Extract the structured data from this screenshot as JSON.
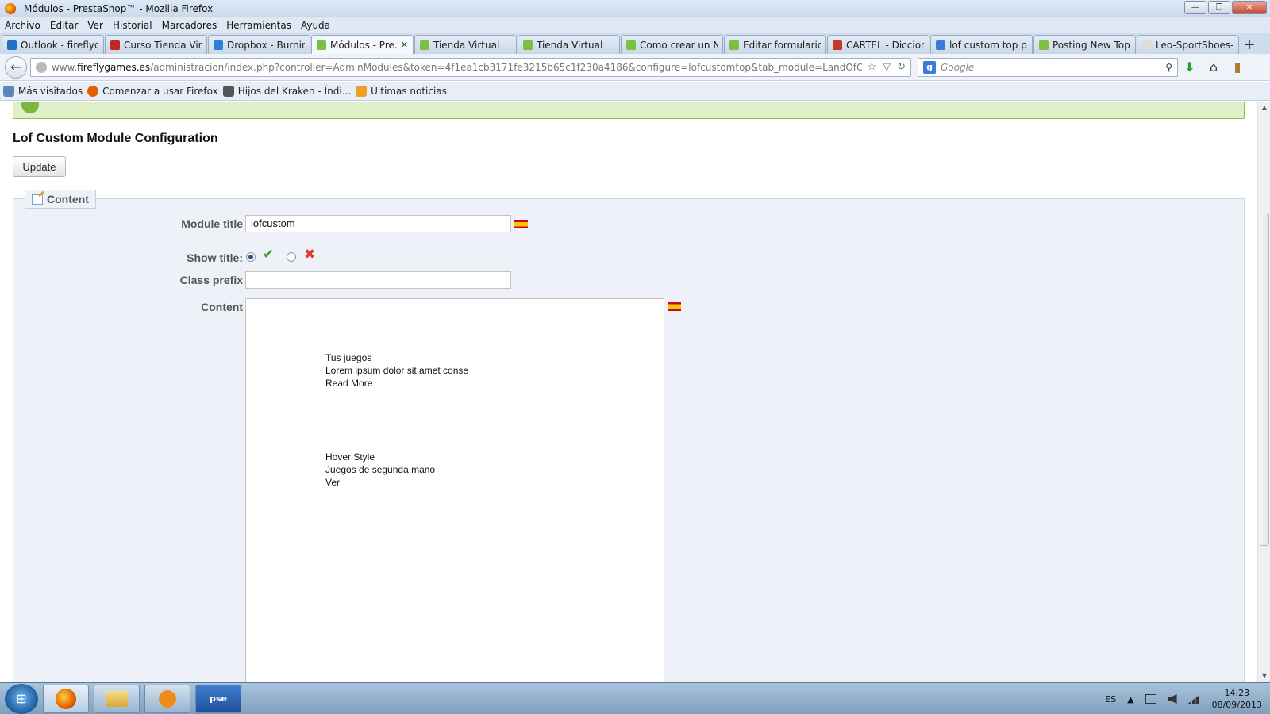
{
  "window": {
    "title": "Módulos - PrestaShop™ - Mozilla Firefox",
    "min_symbol": "—",
    "restore_symbol": "❐",
    "close_symbol": "✕"
  },
  "menu": {
    "items": [
      "Archivo",
      "Editar",
      "Ver",
      "Historial",
      "Marcadores",
      "Herramientas",
      "Ayuda"
    ]
  },
  "tabs": [
    {
      "label": "Outlook - fireflyd...",
      "icon_color": "#1f6fc5"
    },
    {
      "label": "Curso Tienda Virt...",
      "icon_color": "#c02525"
    },
    {
      "label": "Dropbox - Burnin...",
      "icon_color": "#2b7fd6"
    },
    {
      "label": "Módulos - Pre...",
      "icon_color": "#7ac142",
      "active": true,
      "close": "✕"
    },
    {
      "label": "Tienda Virtual",
      "icon_color": "#7ac142"
    },
    {
      "label": "Tienda Virtual",
      "icon_color": "#7ac142"
    },
    {
      "label": "Como crear un N...",
      "icon_color": "#7ac142"
    },
    {
      "label": "Editar formulario ...",
      "icon_color": "#7ac142"
    },
    {
      "label": "CARTEL - Diccion...",
      "icon_color": "#c23b22"
    },
    {
      "label": "lof custom top pr...",
      "icon_color": "#3b7bd6"
    },
    {
      "label": "Posting New Topi...",
      "icon_color": "#7ac142"
    },
    {
      "label": "Leo-SportShoes-P...",
      "icon_color": "#dddddd"
    }
  ],
  "new_tab_symbol": "+",
  "navbar": {
    "back_symbol": "←",
    "url_prefix": "www.",
    "url_domain": "fireflygames.es",
    "url_path": "/administracion/index.php?controller=AdminModules&token=4f1ea1cb3171fe3215b65c1f230a4186&configure=lofcustomtop&tab_module=LandOfCoder&module_name=lo",
    "star_symbol": "☆",
    "dropdown_symbol": "▽",
    "reload_symbol": "↻",
    "search_engine_letter": "g",
    "search_placeholder": "Google",
    "search_symbol": "⚲",
    "download_symbol": "⬇",
    "home_symbol": "⌂",
    "bookmark_symbol": "▮"
  },
  "bookmarks": [
    {
      "label": "Más visitados",
      "icon_color": "#5b86b8"
    },
    {
      "label": "Comenzar a usar Firefox",
      "icon_color": "#e66000"
    },
    {
      "label": "Hijos del Kraken - Índi...",
      "icon_color": "#555555"
    },
    {
      "label": "Últimas noticias",
      "icon_color": "#f0a020"
    }
  ],
  "page": {
    "title": "Lof Custom Module Configuration",
    "update_label": "Update",
    "fieldset_legend": "Content",
    "fields": {
      "module_title_label": "Module title",
      "module_title_value": "lofcustom",
      "show_title_label": "Show title:",
      "show_title_yes_symbol": "✔",
      "show_title_no_symbol": "✖",
      "class_prefix_label": "Class prefix",
      "class_prefix_value": "",
      "content_label": "Content"
    },
    "editor": {
      "block1": [
        "Tus juegos",
        "Lorem ipsum dolor sit amet conse",
        "Read More"
      ],
      "block2": [
        "Hover Style",
        "Juegos de segunda mano",
        "Ver"
      ]
    }
  },
  "scrollbar": {
    "up_symbol": "▲",
    "down_symbol": "▼"
  },
  "taskbar": {
    "start_symbol": "⊞",
    "apps": [
      {
        "label": "",
        "name": "firefox"
      },
      {
        "label": "",
        "name": "explorer"
      },
      {
        "label": "",
        "name": "media-player"
      },
      {
        "label": "pse",
        "name": "photoshop-elements"
      }
    ],
    "tray": {
      "language": "ES",
      "arrow_symbol": "▲",
      "time": "14:23",
      "date": "08/09/2013"
    }
  }
}
